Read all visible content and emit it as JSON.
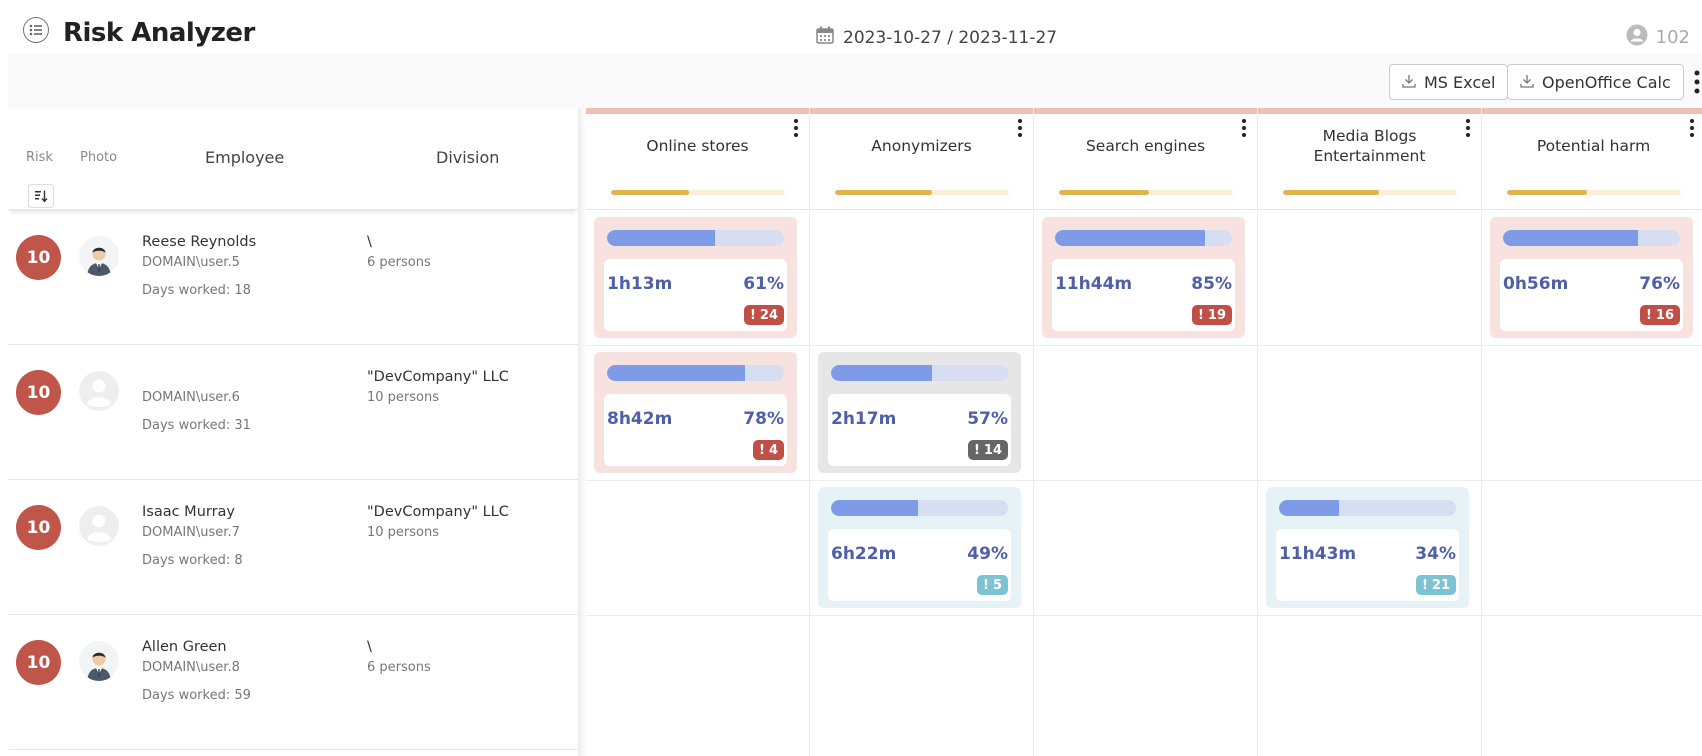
{
  "app": {
    "title": "Risk Analyzer",
    "date_range": "2023-10-27 / 2023-11-27",
    "user_count": "102"
  },
  "toolbar": {
    "excel_label": "MS Excel",
    "calc_label": "OpenOffice Calc"
  },
  "table_header": {
    "risk": "Risk",
    "photo": "Photo",
    "employee": "Employee",
    "division": "Division"
  },
  "categories": [
    {
      "label": "Online stores",
      "progress": 0.45
    },
    {
      "label": "Anonymizers",
      "progress": 0.56
    },
    {
      "label": "Search engines",
      "progress": 0.52
    },
    {
      "label": "Media Blogs Entertainment",
      "label_line1": "Media Blogs",
      "label_line2": "Entertainment",
      "progress": 0.55
    },
    {
      "label": "Potential harm",
      "progress": 0.46
    }
  ],
  "rows": [
    {
      "risk": "10",
      "photo": "person-photo",
      "name": "Reese Reynolds",
      "login": "DOMAIN\\user.5",
      "days": "Days worked: 18",
      "division": "\\",
      "persons": "6 persons"
    },
    {
      "risk": "10",
      "photo": "placeholder-photo",
      "name": "",
      "login": "DOMAIN\\user.6",
      "days": "Days worked: 31",
      "division": "\"DevCompany\" LLC",
      "persons": "10 persons"
    },
    {
      "risk": "10",
      "photo": "placeholder-photo",
      "name": "Isaac Murray",
      "login": "DOMAIN\\user.7",
      "days": "Days worked: 8",
      "division": "\"DevCompany\" LLC",
      "persons": "10 persons"
    },
    {
      "risk": "10",
      "photo": "person-photo",
      "name": "Allen Green",
      "login": "DOMAIN\\user.8",
      "days": "Days worked: 59",
      "division": "\\",
      "persons": "6 persons"
    }
  ],
  "cells": [
    {
      "row": 0,
      "col": 0,
      "time": "1h13m",
      "pct": "61%",
      "fill": 0.61,
      "alerts": "24",
      "tone": "red"
    },
    {
      "row": 0,
      "col": 2,
      "time": "11h44m",
      "pct": "85%",
      "fill": 0.85,
      "alerts": "19",
      "tone": "red"
    },
    {
      "row": 0,
      "col": 4,
      "time": "0h56m",
      "pct": "76%",
      "fill": 0.76,
      "alerts": "16",
      "tone": "red"
    },
    {
      "row": 1,
      "col": 0,
      "time": "8h42m",
      "pct": "78%",
      "fill": 0.78,
      "alerts": "4",
      "tone": "red"
    },
    {
      "row": 1,
      "col": 1,
      "time": "2h17m",
      "pct": "57%",
      "fill": 0.57,
      "alerts": "14",
      "tone": "grey"
    },
    {
      "row": 2,
      "col": 1,
      "time": "6h22m",
      "pct": "49%",
      "fill": 0.49,
      "alerts": "5",
      "tone": "blue"
    },
    {
      "row": 2,
      "col": 3,
      "time": "11h43m",
      "pct": "34%",
      "fill": 0.34,
      "alerts": "21",
      "tone": "blue"
    }
  ],
  "colors": {
    "risk_badge": "#c0554a",
    "alert_red": "#bf4f47",
    "alert_grey": "#666666",
    "alert_blue": "#7ec3d4",
    "bar_fill": "#7d9be6",
    "category_bar": "#e0b44c",
    "category_topline": "#ecc1b2"
  }
}
